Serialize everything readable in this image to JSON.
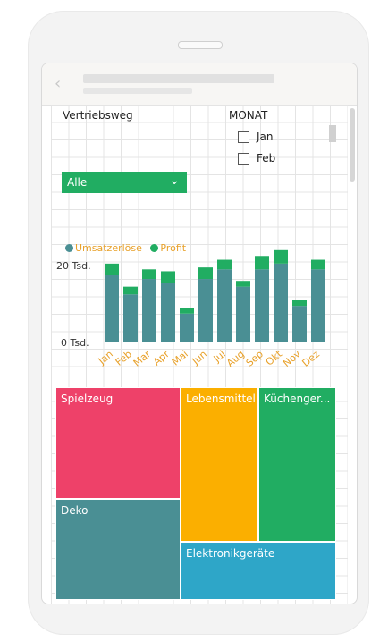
{
  "colors": {
    "umsatz": "#4a8f94",
    "profit": "#21ad62",
    "legend_text": "#e8a12a"
  },
  "filters": {
    "vertriebsweg_label": "Vertriebsweg",
    "vertriebsweg_value": "Alle",
    "monat_label": "MONAT",
    "monat_options": [
      "Jan",
      "Feb"
    ]
  },
  "chart_data": {
    "type": "bar",
    "stacked": true,
    "categories": [
      "Jan",
      "Feb",
      "Mar",
      "Apr",
      "Mai",
      "Jun",
      "Jul",
      "Aug",
      "Sep",
      "Okt",
      "Nov",
      "Dez"
    ],
    "series": [
      {
        "name": "Umsatzerlöse",
        "values": [
          17.5,
          12.5,
          16.5,
          15.5,
          7.5,
          16.5,
          19,
          14.5,
          19,
          20.5,
          9.5,
          19
        ]
      },
      {
        "name": "Profit",
        "values": [
          3,
          2,
          2.5,
          3,
          1.5,
          3,
          2.5,
          1.5,
          3.5,
          3.5,
          1.5,
          2.5
        ]
      }
    ],
    "ytick_labels": [
      "0 Tsd.",
      "20 Tsd."
    ],
    "yticks": [
      0,
      20
    ],
    "ylim": [
      0,
      20
    ],
    "grid": true,
    "legend_position": "top-left"
  },
  "treemap": [
    {
      "label": "Spielzeug",
      "color": "#ee4169"
    },
    {
      "label": "Lebensmittel",
      "color": "#fbaf00"
    },
    {
      "label": "Küchenger...",
      "color": "#21ad62"
    },
    {
      "label": "Deko",
      "color": "#4a8f94"
    },
    {
      "label": "Elektronikgeräte",
      "color": "#2ea6c8"
    }
  ]
}
